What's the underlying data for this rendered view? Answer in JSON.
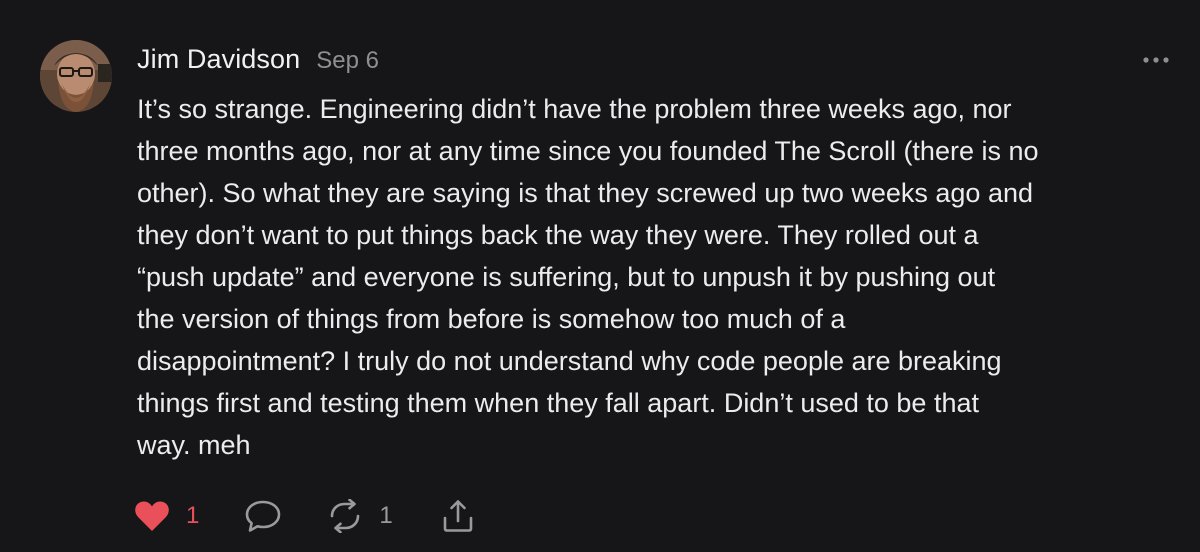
{
  "post": {
    "author": "Jim Davidson",
    "date": "Sep 6",
    "text": "It’s so strange. Engineering didn’t have the problem three weeks ago, nor\nthree months ago, nor at any time since you founded The Scroll (there is no\nother). So what they are saying is that they screwed up two weeks ago and\nthey don’t want to put things back the way they were. They rolled out a\n“push update” and everyone is suffering, but to unpush it by pushing out\nthe version of things from before is somehow too much of a\ndisappointment? I truly do not understand why code people are breaking\nthings first and testing them when they fall apart. Didn’t used to be that\nway. meh",
    "more_icon": "ellipsis-icon",
    "avatar": "avatar-photo"
  },
  "actions": {
    "like": {
      "icon": "heart-icon",
      "count": "1",
      "color": "#e9505a"
    },
    "reply": {
      "icon": "comment-icon"
    },
    "restack": {
      "icon": "restack-icon",
      "count": "1"
    },
    "share": {
      "icon": "share-icon"
    }
  },
  "theme": {
    "background": "#161517",
    "text": "#ecebed",
    "muted": "#8f8e93"
  }
}
